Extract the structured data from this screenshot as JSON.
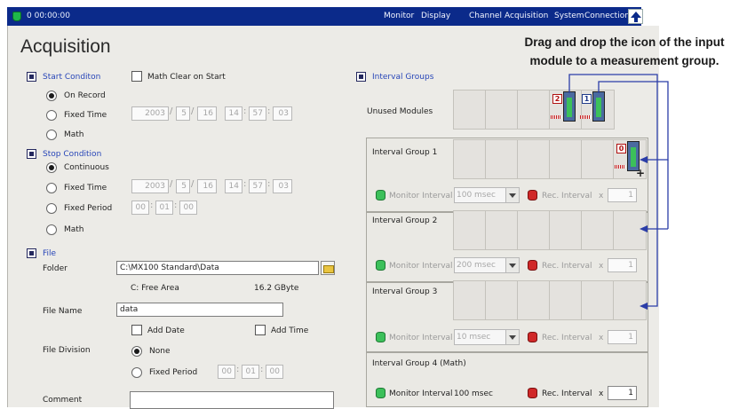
{
  "titlebar": {
    "time": "0 00:00:00",
    "menu": [
      "Monitor",
      "Display",
      "Channel",
      "Acquisition",
      "System",
      "Connection"
    ]
  },
  "page_title": "Acquisition",
  "tip": "Drag and drop the icon of the input module to a measurement group.",
  "start": {
    "heading": "Start Conditon",
    "math_clear": "Math Clear on Start",
    "on_record": "On Record",
    "fixed_time": "Fixed Time",
    "math": "Math",
    "date": [
      "2003",
      "5",
      "16"
    ],
    "time": [
      "14",
      "57",
      "03"
    ]
  },
  "stop": {
    "heading": "Stop Condition",
    "continuous": "Continuous",
    "fixed_time": "Fixed Time",
    "fixed_period": "Fixed Period",
    "math": "Math",
    "date": [
      "2003",
      "5",
      "16"
    ],
    "time": [
      "14",
      "57",
      "03"
    ],
    "period": [
      "00",
      "01",
      "00"
    ]
  },
  "file": {
    "heading": "File",
    "folder_label": "Folder",
    "folder_value": "C:\\MX100 Standard\\Data",
    "free_area_label": "C: Free Area",
    "free_area_value": "16.2 GByte",
    "name_label": "File Name",
    "name_value": "data",
    "add_date": "Add Date",
    "add_time": "Add Time",
    "division_label": "File Division",
    "none": "None",
    "fixed_period": "Fixed Period",
    "period": [
      "00",
      "01",
      "00"
    ],
    "comment_label": "Comment"
  },
  "interval": {
    "heading": "Interval Groups",
    "unused": "Unused Modules",
    "monitor_label": "Monitor Interval",
    "rec_label": "Rec. Interval",
    "x": "x",
    "groups": [
      {
        "name": "Interval Group 1",
        "monitor": "100 msec",
        "rec": "1"
      },
      {
        "name": "Interval Group 2",
        "monitor": "200 msec",
        "rec": "1"
      },
      {
        "name": "Interval Group 3",
        "monitor": "10 msec",
        "rec": "1"
      },
      {
        "name": "Interval Group 4 (Math)",
        "monitor": "100 msec",
        "rec": "1"
      }
    ],
    "module_labels": [
      "2",
      "1",
      "0"
    ]
  },
  "cursor_text": "+"
}
